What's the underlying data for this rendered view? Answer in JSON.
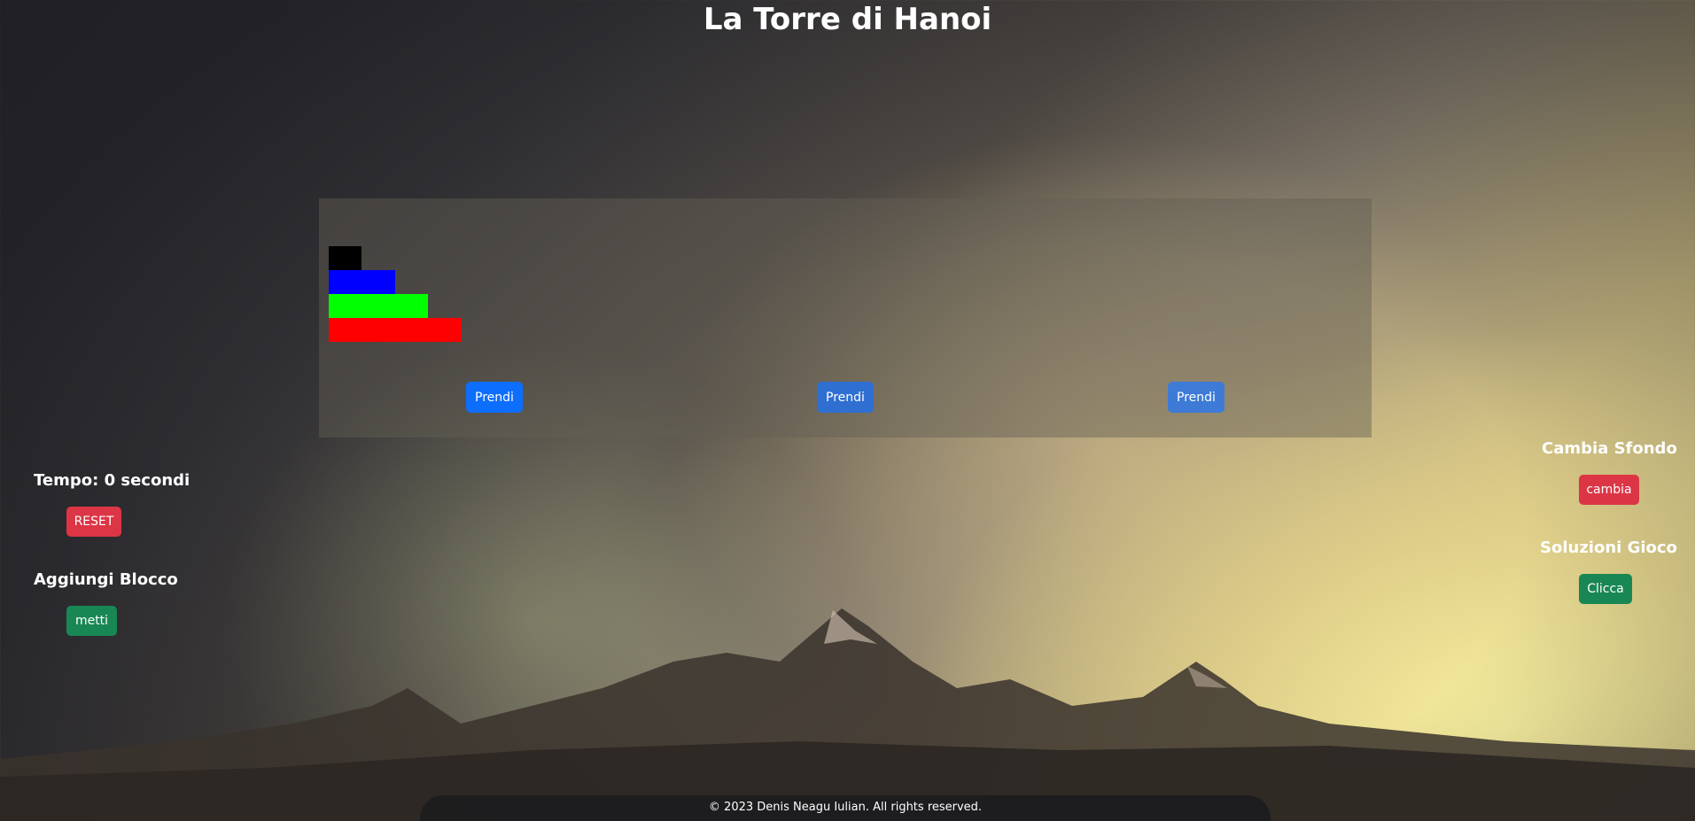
{
  "title": "La Torre di Hanoi",
  "disks": [
    {
      "color": "#000000",
      "tower": 1
    },
    {
      "color": "#0000ff",
      "tower": 1
    },
    {
      "color": "#00ff00",
      "tower": 1
    },
    {
      "color": "#ff0000",
      "tower": 1
    }
  ],
  "towers": [
    {
      "button_label": "Prendi",
      "button_color": "#0d6efd"
    },
    {
      "button_label": "Prendi",
      "button_color": "#2f6fd1"
    },
    {
      "button_label": "Prendi",
      "button_color": "#3d7bd6"
    }
  ],
  "left_panel": {
    "timer_label": "Tempo: 0 secondi",
    "reset_label": "RESET",
    "add_block_label": "Aggiungi Blocco",
    "add_block_button": "metti"
  },
  "right_panel": {
    "background_label": "Cambia Sfondo",
    "background_button": "cambia",
    "solutions_label": "Soluzioni Gioco",
    "solutions_button": "Clicca"
  },
  "footer": "© 2023 Denis Neagu Iulian. All rights reserved.",
  "colors": {
    "danger": "#dc3545",
    "success": "#198754",
    "primary": "#0d6efd"
  }
}
